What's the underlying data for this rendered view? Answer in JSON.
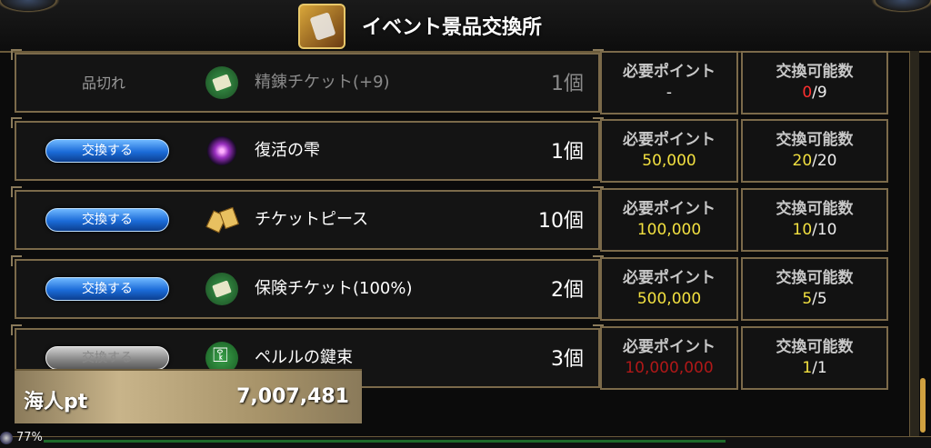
{
  "header": {
    "title": "イベント景品交換所"
  },
  "labels": {
    "required_points": "必要ポイント",
    "exchangeable": "交換可能数"
  },
  "rows": [
    {
      "action": "品切れ",
      "item": "精錬チケット(+9)",
      "qty": "1個",
      "points": "-",
      "left": "0",
      "total": "/9"
    },
    {
      "action": "交換する",
      "item": "復活の雫",
      "qty": "1個",
      "points": "50,000",
      "left": "20",
      "total": "/20"
    },
    {
      "action": "交換する",
      "item": "チケットピース",
      "qty": "10個",
      "points": "100,000",
      "left": "10",
      "total": "/10"
    },
    {
      "action": "交換する",
      "item": "保険チケット(100%)",
      "qty": "2個",
      "points": "500,000",
      "left": "5",
      "total": "/5"
    },
    {
      "action": "交換する",
      "item": "ペルルの鍵束",
      "qty": "3個",
      "points": "10,000,000",
      "left": "1",
      "total": "/1"
    }
  ],
  "player": {
    "label": "海人pt",
    "points": "7,007,481"
  },
  "status": {
    "battery": "77%"
  },
  "colors": {
    "accent_yellow": "#f2e040",
    "insufficient_red": "#b01818",
    "button_blue": "#1b6bd8"
  },
  "icons": {
    "title": "shop-icon",
    "row_icons": [
      "ticket-icon",
      "drop-icon",
      "ticket-piece-icon",
      "ticket-icon",
      "key-ring-icon"
    ]
  }
}
